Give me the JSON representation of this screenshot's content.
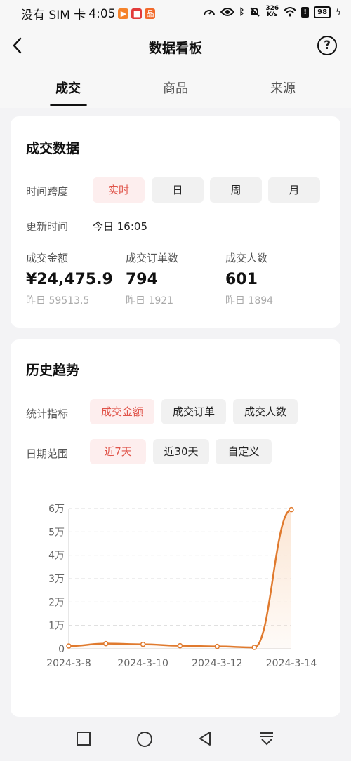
{
  "status_bar": {
    "carrier": "没有 SIM 卡",
    "time": "4:05",
    "net_speed_value": "326",
    "net_speed_unit": "K/s",
    "battery": "98"
  },
  "header": {
    "title": "数据看板",
    "help_glyph": "?"
  },
  "tabs": [
    {
      "label": "成交",
      "active": true
    },
    {
      "label": "商品",
      "active": false
    },
    {
      "label": "来源",
      "active": false
    }
  ],
  "deal_card": {
    "title": "成交数据",
    "time_span_label": "时间跨度",
    "time_options": [
      "实时",
      "日",
      "周",
      "月"
    ],
    "selected_time_option": "实时",
    "update_label": "更新时间",
    "update_value": "今日 16:05",
    "stats": [
      {
        "label": "成交金额",
        "value": "¥24,475.9",
        "prev": "昨日 59513.5"
      },
      {
        "label": "成交订单数",
        "value": "794",
        "prev": "昨日 1921"
      },
      {
        "label": "成交人数",
        "value": "601",
        "prev": "昨日 1894"
      }
    ]
  },
  "trend_card": {
    "title": "历史趋势",
    "metric_label": "统计指标",
    "metric_options": [
      "成交金额",
      "成交订单",
      "成交人数"
    ],
    "selected_metric": "成交金额",
    "range_label": "日期范围",
    "range_options": [
      "近7天",
      "近30天",
      "自定义"
    ],
    "selected_range": "近7天"
  },
  "chart_data": {
    "type": "area",
    "x": [
      "2024-3-8",
      "2024-3-9",
      "2024-3-10",
      "2024-3-11",
      "2024-3-12",
      "2024-3-13",
      "2024-3-14"
    ],
    "x_tick_labels": [
      "2024-3-8",
      "2024-3-10",
      "2024-3-12",
      "2024-3-14"
    ],
    "values": [
      1200,
      2200,
      1900,
      1300,
      1000,
      600,
      59513.5
    ],
    "y_ticks": [
      0,
      10000,
      20000,
      30000,
      40000,
      50000,
      60000
    ],
    "y_tick_labels": [
      "0",
      "1万",
      "2万",
      "3万",
      "4万",
      "5万",
      "6万"
    ],
    "ylim": [
      0,
      60000
    ],
    "grid": true,
    "line_color": "#e07a2e",
    "fill_color": "#fbe3cf"
  },
  "colors": {
    "accent": "#e0544a",
    "accent_bg": "#fdeeee",
    "line": "#e07a2e"
  }
}
